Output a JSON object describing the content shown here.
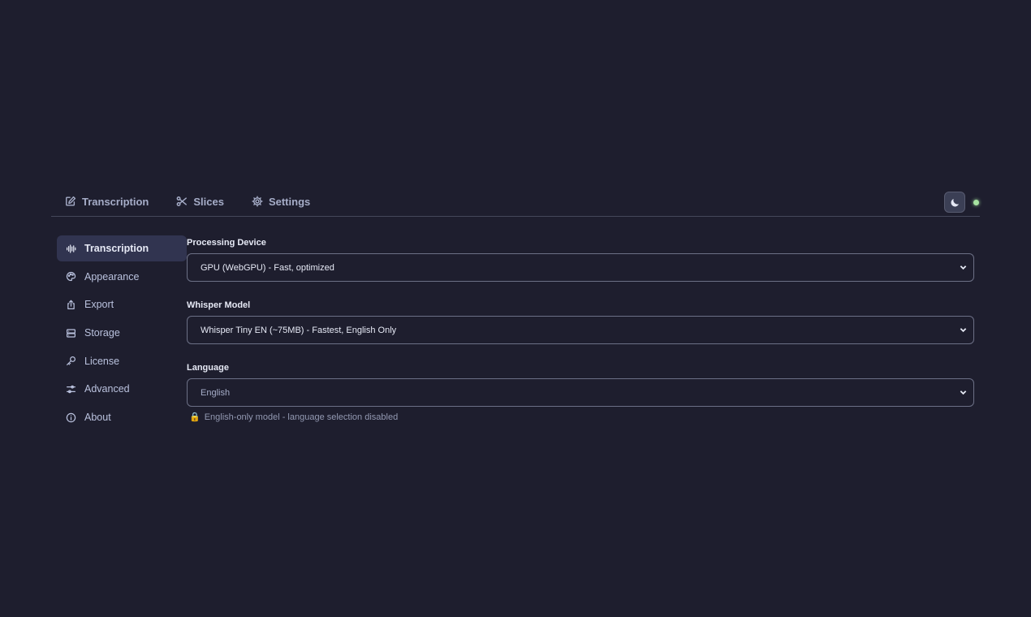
{
  "tabs": [
    {
      "label": "Transcription",
      "icon": "edit-icon"
    },
    {
      "label": "Slices",
      "icon": "scissors-icon"
    },
    {
      "label": "Settings",
      "icon": "gear-icon"
    }
  ],
  "topbar": {
    "theme_icon": "moon-icon",
    "status_color": "#a6e3a1"
  },
  "sidebar": {
    "items": [
      {
        "label": "Transcription",
        "icon": "waveform-icon",
        "active": true
      },
      {
        "label": "Appearance",
        "icon": "palette-icon"
      },
      {
        "label": "Export",
        "icon": "share-icon"
      },
      {
        "label": "Storage",
        "icon": "database-icon"
      },
      {
        "label": "License",
        "icon": "key-icon"
      },
      {
        "label": "Advanced",
        "icon": "sliders-icon"
      },
      {
        "label": "About",
        "icon": "info-icon"
      }
    ]
  },
  "settings": {
    "processing_device": {
      "label": "Processing Device",
      "value": "GPU (WebGPU) - Fast, optimized"
    },
    "whisper_model": {
      "label": "Whisper Model",
      "value": "Whisper Tiny EN (~75MB) - Fastest, English Only"
    },
    "language": {
      "label": "Language",
      "value": "English",
      "disabled": true
    },
    "language_hint": {
      "icon": "🔒",
      "text": "English-only model - language selection disabled"
    }
  },
  "colors": {
    "background": "#1e1e2e",
    "accent_active": "#313450",
    "status": "#a6e3a1"
  }
}
